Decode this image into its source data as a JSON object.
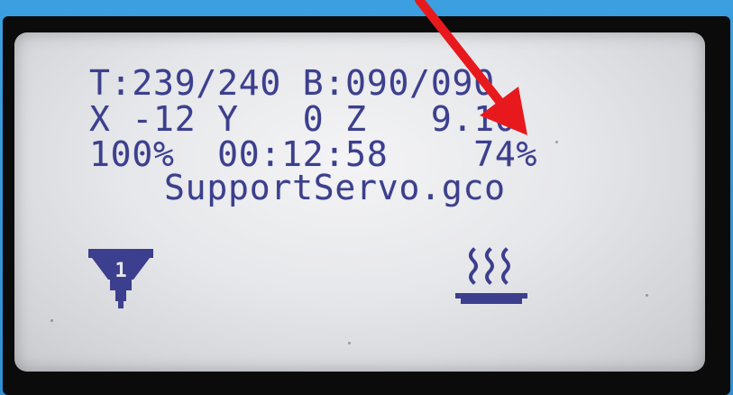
{
  "lcd": {
    "line1": "T:239/240 B:090/090",
    "line2": "X -12 Y   0 Z   9.10",
    "line3": "100%  00:12:58    74%",
    "line4": "SupportServo.gco"
  },
  "icons": {
    "extruder": "extruder-1-icon",
    "bed": "heated-bed-icon"
  },
  "extruder_number": "1",
  "colors": {
    "lcd_text": "#3c3f8d",
    "lcd_bg": "#e6e7ea",
    "frame": "#3b9fe0",
    "annotation_arrow": "#e8191c"
  }
}
